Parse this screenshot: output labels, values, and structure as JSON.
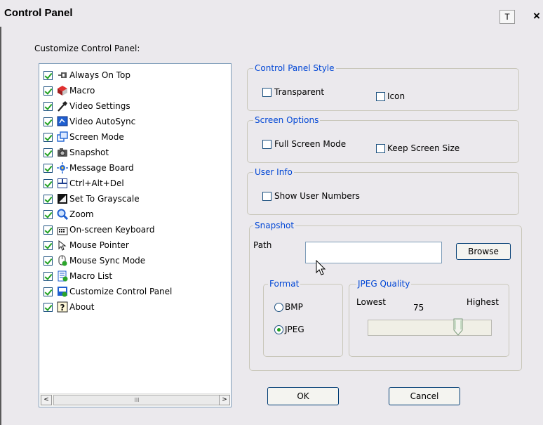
{
  "window": {
    "title": "Control Panel",
    "pin_label": "T",
    "close_label": "×"
  },
  "customize": {
    "heading": "Customize Control Panel:",
    "items": [
      {
        "label": "Always On Top",
        "icon": "pushpin-icon",
        "checked": true
      },
      {
        "label": "Macro",
        "icon": "macro-icon",
        "checked": true
      },
      {
        "label": "Video Settings",
        "icon": "wrench-icon",
        "checked": true
      },
      {
        "label": "Video AutoSync",
        "icon": "autosync-icon",
        "checked": true
      },
      {
        "label": "Screen Mode",
        "icon": "screen-mode-icon",
        "checked": true
      },
      {
        "label": "Snapshot",
        "icon": "camera-icon",
        "checked": true
      },
      {
        "label": "Message Board",
        "icon": "message-board-icon",
        "checked": true
      },
      {
        "label": "Ctrl+Alt+Del",
        "icon": "ctrl-alt-del-icon",
        "checked": true
      },
      {
        "label": "Set To Grayscale",
        "icon": "grayscale-icon",
        "checked": true
      },
      {
        "label": "Zoom",
        "icon": "magnifier-icon",
        "checked": true
      },
      {
        "label": "On-screen Keyboard",
        "icon": "keyboard-icon",
        "checked": true
      },
      {
        "label": "Mouse Pointer",
        "icon": "mouse-pointer-icon",
        "checked": true
      },
      {
        "label": "Mouse Sync Mode",
        "icon": "mouse-sync-icon",
        "checked": true
      },
      {
        "label": "Macro List",
        "icon": "macro-list-icon",
        "checked": true
      },
      {
        "label": "Customize Control Panel",
        "icon": "customize-icon",
        "checked": true
      },
      {
        "label": "About",
        "icon": "help-icon",
        "checked": true
      }
    ],
    "scrollbar": {
      "left": "<",
      "right": ">",
      "grip": "III"
    }
  },
  "style_group": {
    "legend": "Control Panel Style",
    "transparent_label": "Transparent",
    "icon_label": "Icon"
  },
  "screen_group": {
    "legend": "Screen Options",
    "full_screen_label": "Full Screen Mode",
    "keep_size_label": "Keep Screen Size"
  },
  "user_group": {
    "legend": "User Info",
    "show_numbers_label": "Show User Numbers"
  },
  "snapshot_group": {
    "legend": "Snapshot",
    "path_label": "Path",
    "path_value": "",
    "browse_label": "Browse",
    "format": {
      "legend": "Format",
      "bmp_label": "BMP",
      "jpeg_label": "JPEG",
      "selected": "JPEG"
    },
    "quality": {
      "legend": "JPEG Quality",
      "lowest_label": "Lowest",
      "value_label": "75",
      "highest_label": "Highest",
      "value": 75
    }
  },
  "buttons": {
    "ok": "OK",
    "cancel": "Cancel"
  },
  "colors": {
    "accent": "#0046d5",
    "check": "#21a121",
    "dialog_bg": "#ebe9ed"
  }
}
